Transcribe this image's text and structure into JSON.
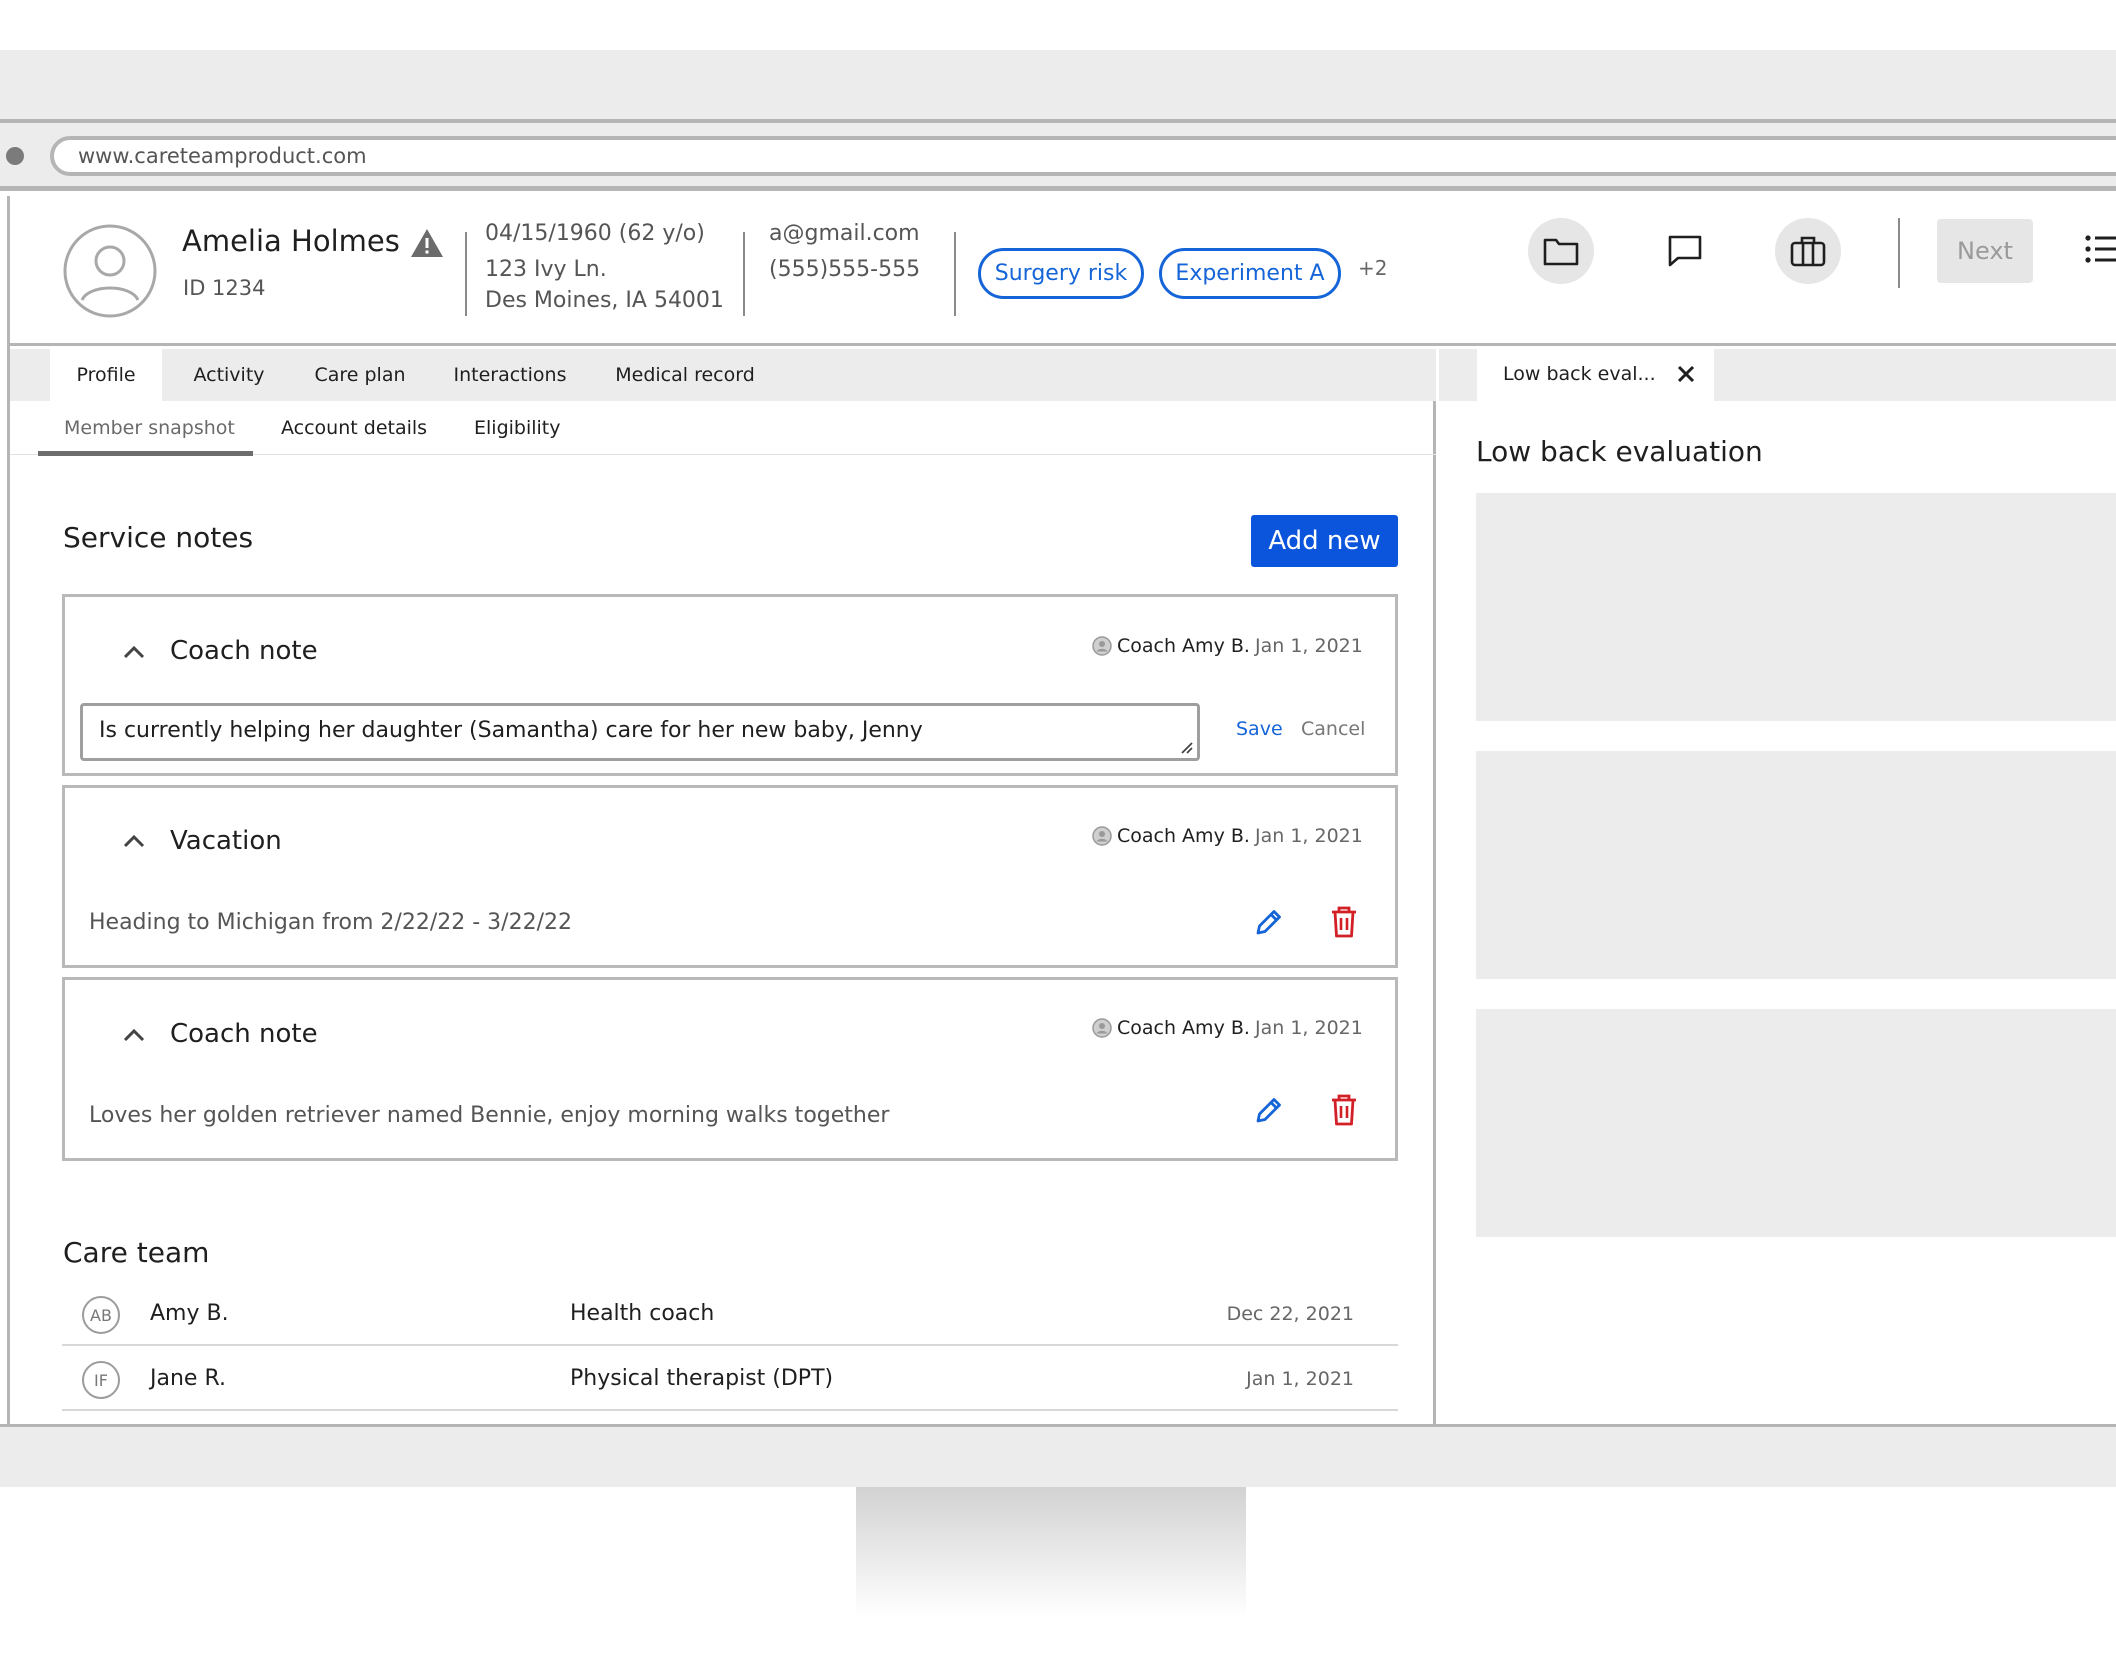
{
  "browser": {
    "url": "www.careteamproduct.com"
  },
  "member": {
    "name": "Amelia Holmes",
    "id": "ID 1234",
    "dob": "04/15/1960  (62 y/o)",
    "address_line1": "123 Ivy Ln.",
    "address_line2": "Des Moines, IA  54001",
    "email": "a@gmail.com",
    "phone": "(555)555-555",
    "tags": [
      "Surgery risk",
      "Experiment A"
    ],
    "tags_more": "+2"
  },
  "header_actions": {
    "folder_icon": "folder-icon",
    "chat_icon": "chat-icon",
    "briefcase_icon": "briefcase-icon",
    "next_label": "Next",
    "list_icon": "list-icon"
  },
  "tabs": [
    {
      "label": "Profile",
      "active": true
    },
    {
      "label": "Activity",
      "active": false
    },
    {
      "label": "Care plan",
      "active": false
    },
    {
      "label": "Interactions",
      "active": false
    },
    {
      "label": "Medical record",
      "active": false
    }
  ],
  "subtabs": [
    {
      "label": "Member snapshot",
      "active": true
    },
    {
      "label": "Account details",
      "active": false
    },
    {
      "label": "Eligibility",
      "active": false
    }
  ],
  "service_notes": {
    "title": "Service notes",
    "add_label": "Add new",
    "notes": [
      {
        "title": "Coach note",
        "author": "Coach Amy B.",
        "date": "Jan 1, 2021",
        "text": "Is currently helping her daughter (Samantha) care for her new baby, Jenny",
        "editing": true,
        "save_label": "Save",
        "cancel_label": "Cancel"
      },
      {
        "title": "Vacation",
        "author": "Coach Amy B.",
        "date": "Jan 1, 2021",
        "text": "Heading to Michigan from 2/22/22 - 3/22/22",
        "editing": false
      },
      {
        "title": "Coach note",
        "author": "Coach Amy B.",
        "date": "Jan 1, 2021",
        "text": "Loves her golden retriever named Bennie, enjoy morning walks together",
        "editing": false
      }
    ]
  },
  "care_team": {
    "title": "Care team",
    "members": [
      {
        "initials": "AB",
        "name": "Amy B.",
        "role": "Health coach",
        "date": "Dec 22, 2021"
      },
      {
        "initials": "IF",
        "name": "Jane R.",
        "role": "Physical therapist (DPT)",
        "date": "Jan 1, 2021"
      }
    ]
  },
  "side_panel": {
    "tab_label": "Low back eval...",
    "title": "Low back evaluation"
  },
  "colors": {
    "primary": "#0b55dc",
    "link": "#1565d8",
    "danger": "#d32027",
    "chrome_gray": "#ececec",
    "border_gray": "#b5b5b5"
  }
}
